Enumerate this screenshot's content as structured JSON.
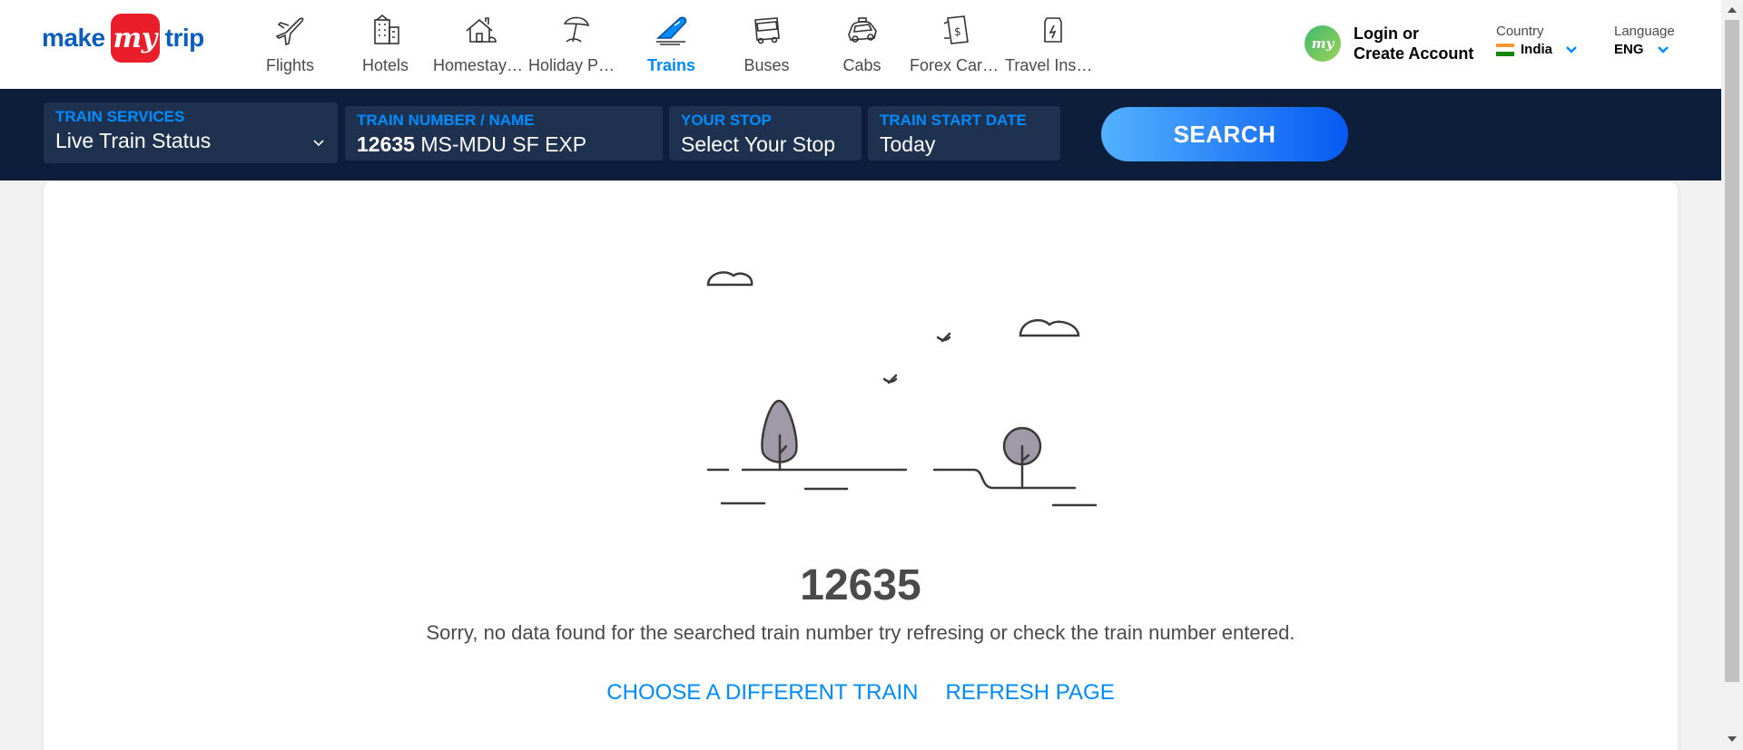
{
  "brand": {
    "logo_left": "make",
    "logo_mid": "my",
    "logo_right": "trip"
  },
  "nav": [
    {
      "label": "Flights",
      "icon": "flight-icon"
    },
    {
      "label": "Hotels",
      "icon": "hotel-icon"
    },
    {
      "label": "Homestays & Villas",
      "icon": "homestay-icon"
    },
    {
      "label": "Holiday Packages",
      "icon": "holiday-icon"
    },
    {
      "label": "Trains",
      "icon": "train-icon",
      "active": true
    },
    {
      "label": "Buses",
      "icon": "bus-icon"
    },
    {
      "label": "Cabs",
      "icon": "cab-icon"
    },
    {
      "label": "Forex Card & Currency",
      "icon": "forex-icon"
    },
    {
      "label": "Travel Insurance",
      "icon": "insurance-icon"
    }
  ],
  "account": {
    "avatar_text": "my",
    "line1": "Login or",
    "line2": "Create Account"
  },
  "country": {
    "caption": "Country",
    "value": "India"
  },
  "language": {
    "caption": "Language",
    "value": "ENG"
  },
  "search": {
    "service_label": "TRAIN SERVICES",
    "service_value": "Live Train Status",
    "train_label": "TRAIN NUMBER / NAME",
    "train_number": "12635",
    "train_name": "MS-MDU SF EXP",
    "stop_label": "YOUR STOP",
    "stop_value": "Select Your Stop",
    "date_label": "TRAIN START DATE",
    "date_value": "Today",
    "button": "SEARCH"
  },
  "result": {
    "train_number": "12635",
    "message": "Sorry, no data found for the searched train number try refresing or check the train number entered.",
    "choose_link": "CHOOSE A DIFFERENT TRAIN",
    "refresh_link": "REFRESH PAGE"
  },
  "colors": {
    "accent": "#008cff",
    "navy": "#0c1e3a",
    "brand_red": "#e91e2a",
    "brand_blue": "#0b5ebc"
  }
}
